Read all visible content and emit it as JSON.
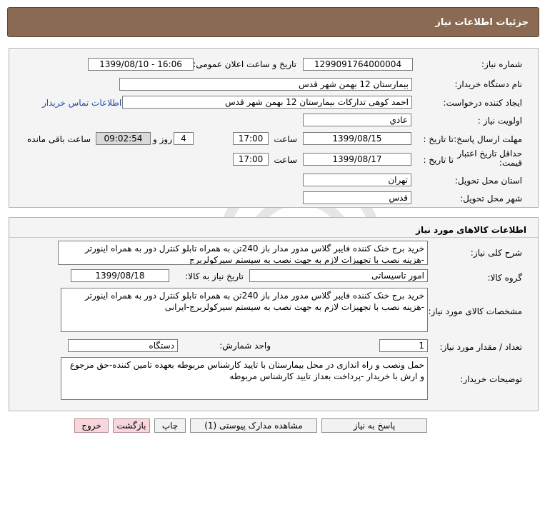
{
  "header": {
    "title": "جزئیات اطلاعات نیاز"
  },
  "info": {
    "need_number_label": "شماره نیاز:",
    "need_number": "1299091764000004",
    "announce_label": "تاریخ و ساعت اعلان عمومی:",
    "announce_value": "1399/08/10 - 16:06",
    "buyer_org_label": "نام دستگاه خریدار:",
    "buyer_org": "بیمارستان 12 بهمن شهر قدس",
    "requester_label": "ایجاد کننده درخواست:",
    "requester": "احمد کوهی تدارکات بیمارستان 12 بهمن شهر قدس",
    "contact_link": "اطلاعات تماس خریدار",
    "priority_label": "اولویت نیاز :",
    "priority": "عادي",
    "deadline_label": "مهلت ارسال پاسخ:",
    "until_date_label": "تا تاریخ :",
    "deadline_date": "1399/08/15",
    "time_label": "ساعت",
    "deadline_time": "17:00",
    "days_value": "4",
    "days_label": "روز و",
    "remaining_time": "09:02:54",
    "remaining_label": "ساعت باقی مانده",
    "validity_label": "حداقل تاریخ اعتبار قیمت:",
    "validity_date": "1399/08/17",
    "validity_time": "17:00",
    "province_label": "استان محل تحویل:",
    "province": "تهران",
    "city_label": "شهر محل تحویل:",
    "city": "قدس"
  },
  "goods": {
    "section_title": "اطلاعات کالاهای مورد نیاز",
    "general_desc_label": "شرح کلی نیاز:",
    "general_desc": "خرید برج خنک کننده فایبر گلاس مدور مدار باز 240تن به همراه تابلو کنترل دور به همراه اینورتر -هزینه نصب با تجهیزات لازم به جهت نصب به سیستم سیرکولربرج",
    "group_label": "گروه کالا:",
    "group_value": "امور تاسیساتی",
    "need_date_label": "تاریخ نیاز به کالا:",
    "need_date": "1399/08/18",
    "specs_label": "مشخصات کالای مورد نیاز:",
    "specs": "خرید برج خنک کننده فایبر گلاس مدور مدار باز 240تن به همراه تابلو کنترل دور به همراه اینورتر -هزینه نصب با تجهیزات لازم به جهت نصب به سیستم سیرکولربرج-ایرانی",
    "qty_label": "تعداد / مقدار مورد نیاز:",
    "qty": "1",
    "unit_label": "واحد شمارش:",
    "unit": "دستگاه",
    "buyer_notes_label": "توضیحات خریدار:",
    "buyer_notes": "حمل ونصب و راه اندازی در محل بیمارستان با تایید کارشناس مربوطه بعهده تامین کننده-حق مرجوع و ارش با خریدار -پرداخت بعداز تایید کارشناس مربوطه"
  },
  "buttons": {
    "reply": "پاسخ به نیاز",
    "attachments": "مشاهده مدارک پیوستی (1)",
    "print": "چاپ",
    "back": "بازگشت",
    "exit": "خروج"
  }
}
